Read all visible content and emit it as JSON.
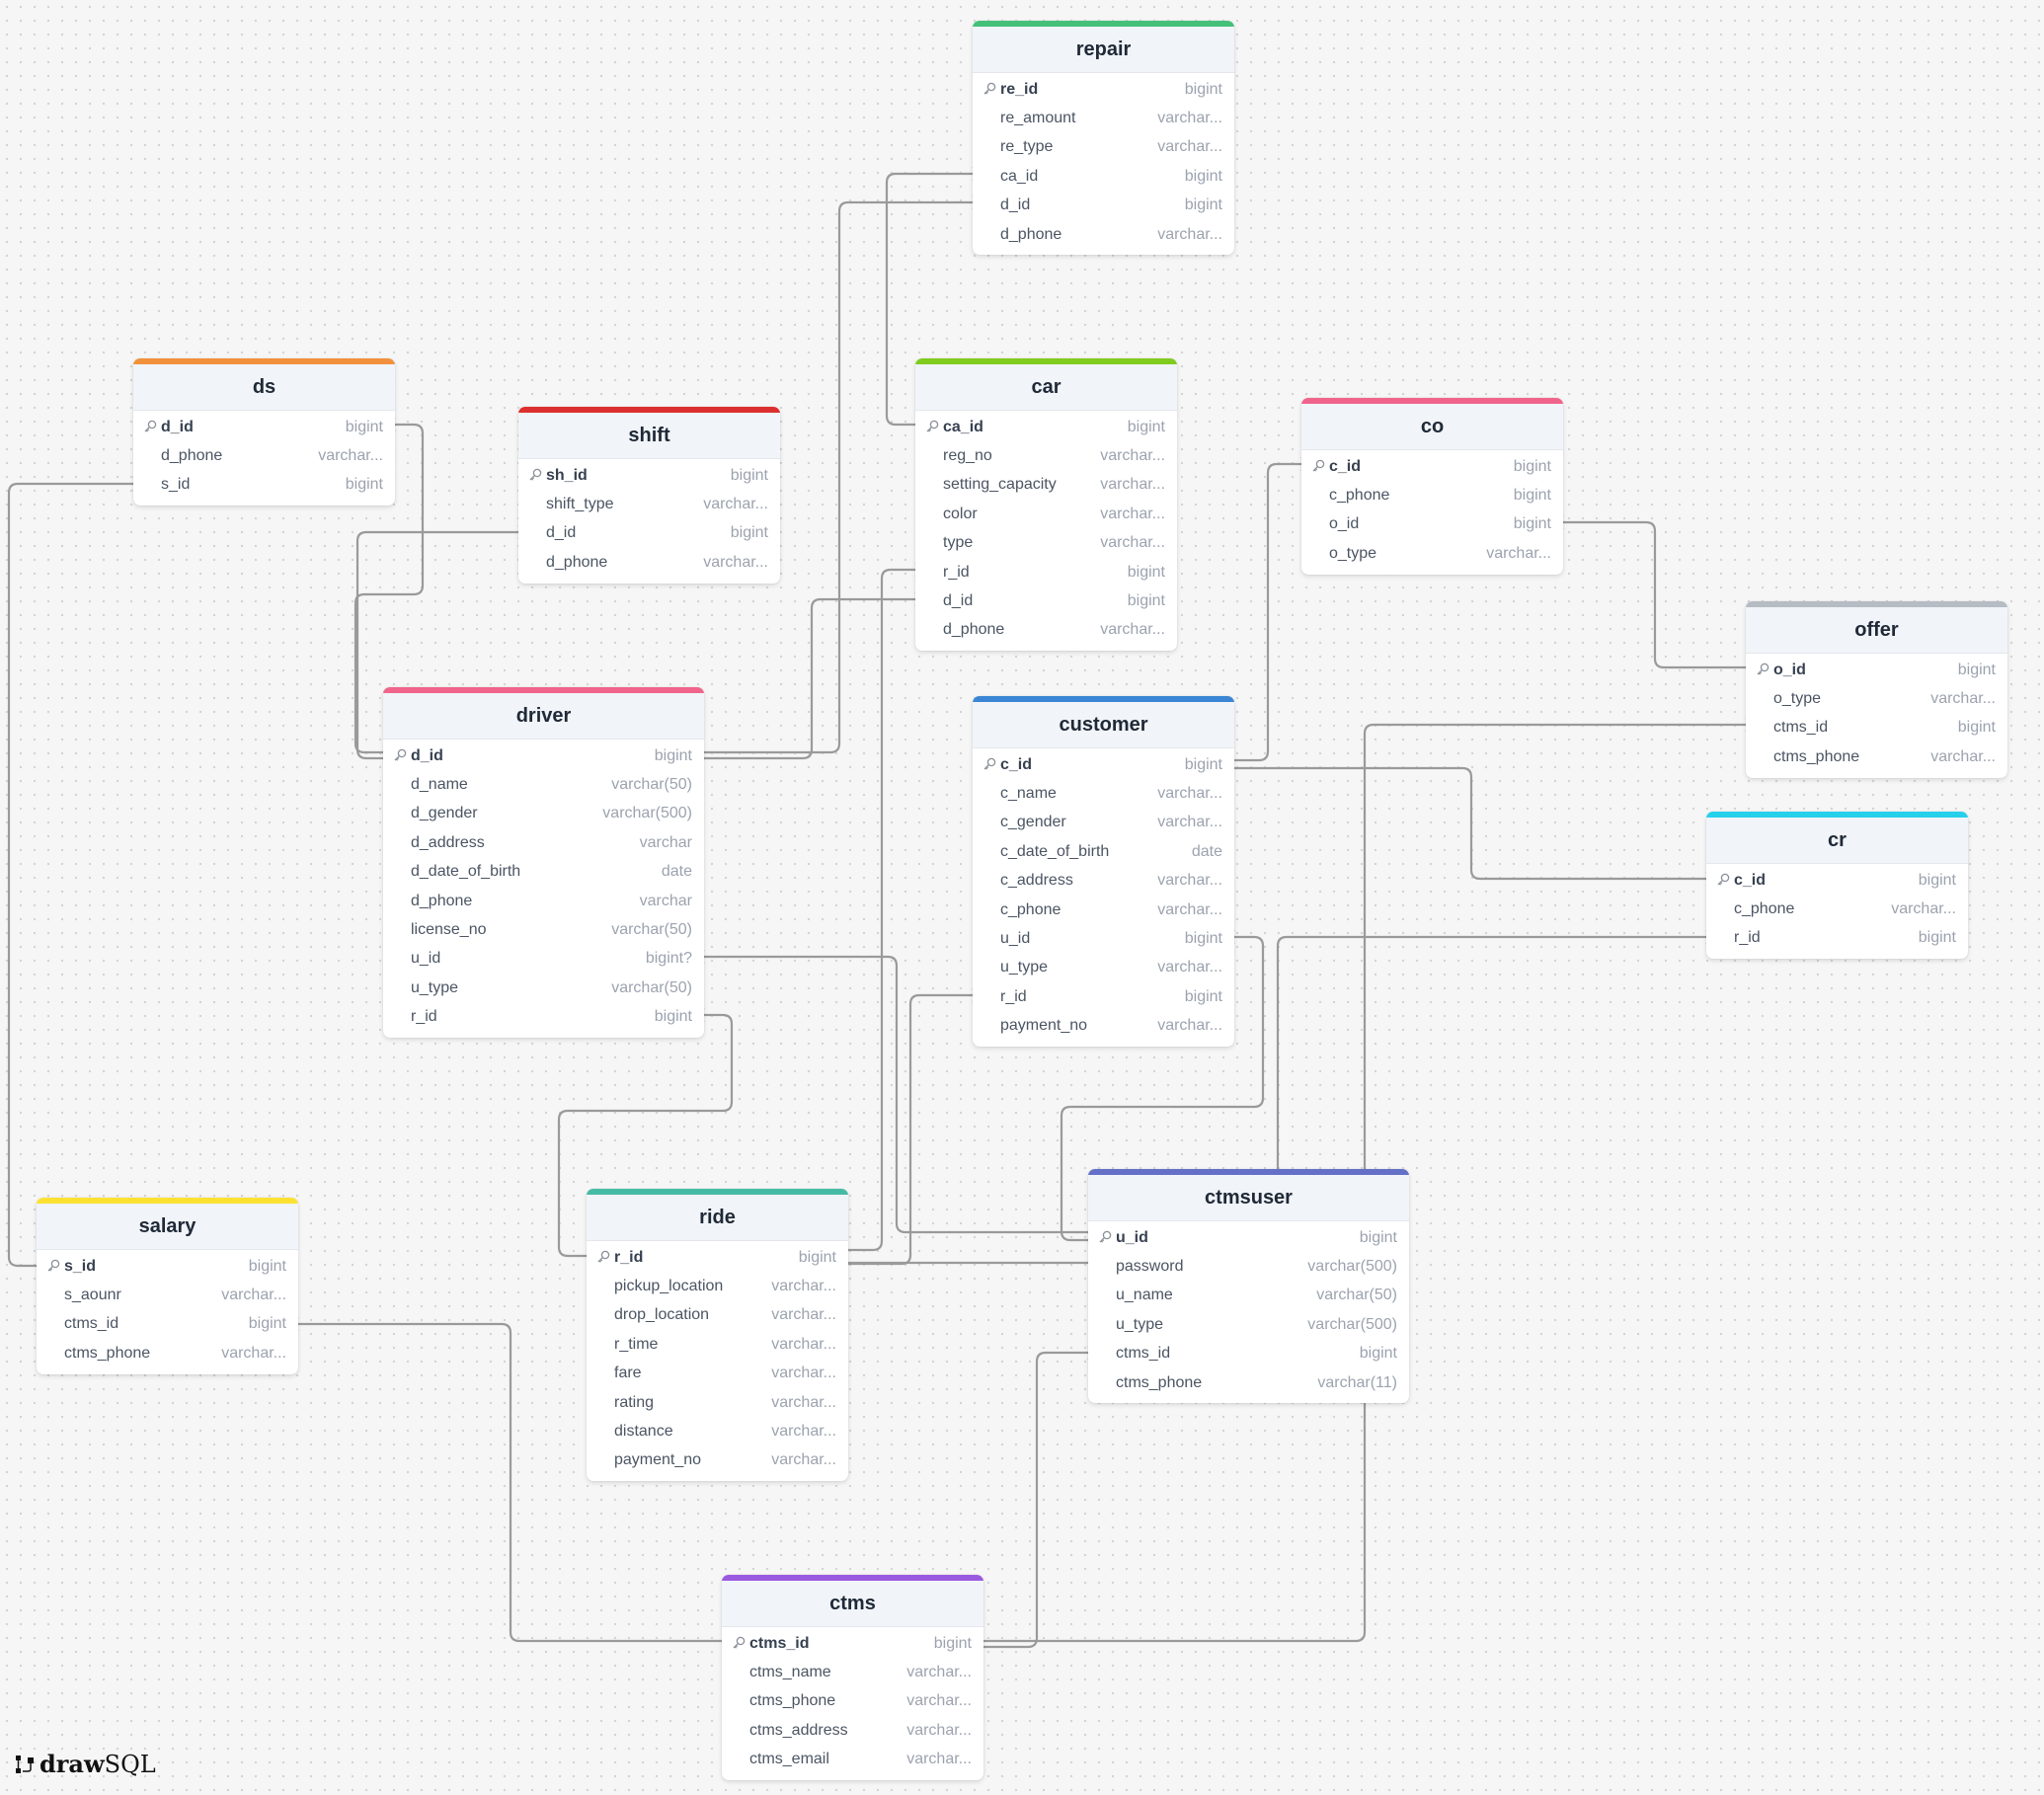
{
  "app": {
    "brand_bold": "draw",
    "brand_light": "SQL"
  },
  "tables": [
    {
      "id": "repair",
      "name": "repair",
      "color": "#45c07a",
      "columns": [
        {
          "name": "re_id",
          "type": "bigint",
          "pk": true
        },
        {
          "name": "re_amount",
          "type": "varchar..."
        },
        {
          "name": "re_type",
          "type": "varchar..."
        },
        {
          "name": "ca_id",
          "type": "bigint"
        },
        {
          "name": "d_id",
          "type": "bigint"
        },
        {
          "name": "d_phone",
          "type": "varchar..."
        }
      ]
    },
    {
      "id": "ds",
      "name": "ds",
      "color": "#f2913d",
      "columns": [
        {
          "name": "d_id",
          "type": "bigint",
          "pk": true
        },
        {
          "name": "d_phone",
          "type": "varchar..."
        },
        {
          "name": "s_id",
          "type": "bigint"
        }
      ]
    },
    {
      "id": "shift",
      "name": "shift",
      "color": "#dc2f2f",
      "columns": [
        {
          "name": "sh_id",
          "type": "bigint",
          "pk": true
        },
        {
          "name": "shift_type",
          "type": "varchar..."
        },
        {
          "name": "d_id",
          "type": "bigint"
        },
        {
          "name": "d_phone",
          "type": "varchar..."
        }
      ]
    },
    {
      "id": "car",
      "name": "car",
      "color": "#7fcc1f",
      "columns": [
        {
          "name": "ca_id",
          "type": "bigint",
          "pk": true
        },
        {
          "name": "reg_no",
          "type": "varchar..."
        },
        {
          "name": "setting_capacity",
          "type": "varchar..."
        },
        {
          "name": "color",
          "type": "varchar..."
        },
        {
          "name": "type",
          "type": "varchar..."
        },
        {
          "name": "r_id",
          "type": "bigint"
        },
        {
          "name": "d_id",
          "type": "bigint"
        },
        {
          "name": "d_phone",
          "type": "varchar..."
        }
      ]
    },
    {
      "id": "co",
      "name": "co",
      "color": "#f0648c",
      "columns": [
        {
          "name": "c_id",
          "type": "bigint",
          "pk": true
        },
        {
          "name": "c_phone",
          "type": "bigint"
        },
        {
          "name": "o_id",
          "type": "bigint"
        },
        {
          "name": "o_type",
          "type": "varchar..."
        }
      ]
    },
    {
      "id": "offer",
      "name": "offer",
      "color": "#b5bcc4",
      "columns": [
        {
          "name": "o_id",
          "type": "bigint",
          "pk": true
        },
        {
          "name": "o_type",
          "type": "varchar..."
        },
        {
          "name": "ctms_id",
          "type": "bigint"
        },
        {
          "name": "ctms_phone",
          "type": "varchar..."
        }
      ]
    },
    {
      "id": "cr",
      "name": "cr",
      "color": "#26d0ea",
      "columns": [
        {
          "name": "c_id",
          "type": "bigint",
          "pk": true
        },
        {
          "name": "c_phone",
          "type": "varchar..."
        },
        {
          "name": "r_id",
          "type": "bigint"
        }
      ]
    },
    {
      "id": "driver",
      "name": "driver",
      "color": "#f0648c",
      "columns": [
        {
          "name": "d_id",
          "type": "bigint",
          "pk": true
        },
        {
          "name": "d_name",
          "type": "varchar(50)"
        },
        {
          "name": "d_gender",
          "type": "varchar(500)"
        },
        {
          "name": "d_address",
          "type": "varchar"
        },
        {
          "name": "d_date_of_birth",
          "type": "date"
        },
        {
          "name": "d_phone",
          "type": "varchar"
        },
        {
          "name": "license_no",
          "type": "varchar(50)"
        },
        {
          "name": "u_id",
          "type": "bigint?"
        },
        {
          "name": "u_type",
          "type": "varchar(50)"
        },
        {
          "name": "r_id",
          "type": "bigint"
        }
      ]
    },
    {
      "id": "customer",
      "name": "customer",
      "color": "#3a86d4",
      "columns": [
        {
          "name": "c_id",
          "type": "bigint",
          "pk": true
        },
        {
          "name": "c_name",
          "type": "varchar..."
        },
        {
          "name": "c_gender",
          "type": "varchar..."
        },
        {
          "name": "c_date_of_birth",
          "type": "date"
        },
        {
          "name": "c_address",
          "type": "varchar..."
        },
        {
          "name": "c_phone",
          "type": "varchar..."
        },
        {
          "name": "u_id",
          "type": "bigint"
        },
        {
          "name": "u_type",
          "type": "varchar..."
        },
        {
          "name": "r_id",
          "type": "bigint"
        },
        {
          "name": "payment_no",
          "type": "varchar..."
        }
      ]
    },
    {
      "id": "salary",
      "name": "salary",
      "color": "#fbe232",
      "columns": [
        {
          "name": "s_id",
          "type": "bigint",
          "pk": true
        },
        {
          "name": "s_aounr",
          "type": "varchar..."
        },
        {
          "name": "ctms_id",
          "type": "bigint"
        },
        {
          "name": "ctms_phone",
          "type": "varchar..."
        }
      ]
    },
    {
      "id": "ride",
      "name": "ride",
      "color": "#45bba5",
      "columns": [
        {
          "name": "r_id",
          "type": "bigint",
          "pk": true
        },
        {
          "name": "pickup_location",
          "type": "varchar..."
        },
        {
          "name": "drop_location",
          "type": "varchar..."
        },
        {
          "name": "r_time",
          "type": "varchar..."
        },
        {
          "name": "fare",
          "type": "varchar..."
        },
        {
          "name": "rating",
          "type": "varchar..."
        },
        {
          "name": "distance",
          "type": "varchar..."
        },
        {
          "name": "payment_no",
          "type": "varchar..."
        }
      ]
    },
    {
      "id": "ctmsuser",
      "name": "ctmsuser",
      "color": "#6470c8",
      "columns": [
        {
          "name": "u_id",
          "type": "bigint",
          "pk": true
        },
        {
          "name": "password",
          "type": "varchar(500)"
        },
        {
          "name": "u_name",
          "type": "varchar(50)"
        },
        {
          "name": "u_type",
          "type": "varchar(500)"
        },
        {
          "name": "ctms_id",
          "type": "bigint"
        },
        {
          "name": "ctms_phone",
          "type": "varchar(11)"
        }
      ]
    },
    {
      "id": "ctms",
      "name": "ctms",
      "color": "#9a5ae0",
      "columns": [
        {
          "name": "ctms_id",
          "type": "bigint",
          "pk": true
        },
        {
          "name": "ctms_name",
          "type": "varchar..."
        },
        {
          "name": "ctms_phone",
          "type": "varchar..."
        },
        {
          "name": "ctms_address",
          "type": "varchar..."
        },
        {
          "name": "ctms_email",
          "type": "varchar..."
        }
      ]
    }
  ],
  "relations": [
    {
      "from": "car.ca_id",
      "to": "repair.ca_id"
    },
    {
      "from": "driver.d_id",
      "to": "repair.d_id"
    },
    {
      "from": "driver.d_id",
      "to": "ds.d_id"
    },
    {
      "from": "salary.s_id",
      "to": "ds.s_id"
    },
    {
      "from": "driver.d_id",
      "to": "shift.d_id"
    },
    {
      "from": "driver.d_id",
      "to": "car.d_id"
    },
    {
      "from": "ride.r_id",
      "to": "car.r_id"
    },
    {
      "from": "customer.c_id",
      "to": "co.c_id"
    },
    {
      "from": "offer.o_id",
      "to": "co.o_id"
    },
    {
      "from": "ctms.ctms_id",
      "to": "offer.ctms_id"
    },
    {
      "from": "customer.c_id",
      "to": "cr.c_id"
    },
    {
      "from": "ctmsuser.u_id",
      "to": "cr.r_id"
    },
    {
      "from": "ctmsuser.u_id",
      "to": "driver.u_id"
    },
    {
      "from": "ride.r_id",
      "to": "driver.r_id"
    },
    {
      "from": "ctmsuser.u_id",
      "to": "customer.u_id"
    },
    {
      "from": "ride.r_id",
      "to": "customer.r_id"
    },
    {
      "from": "ctms.ctms_id",
      "to": "salary.ctms_id"
    },
    {
      "from": "ctms.ctms_id",
      "to": "ctmsuser.ctms_id"
    }
  ]
}
